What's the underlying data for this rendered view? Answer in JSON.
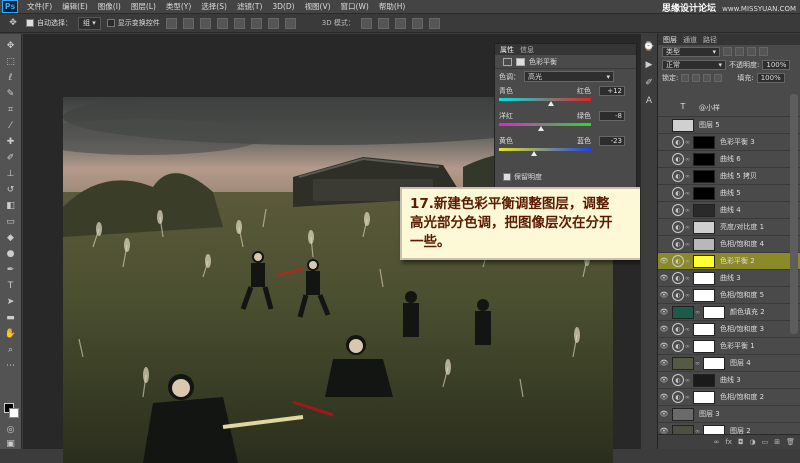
{
  "app": {
    "logo": "Ps",
    "menu": [
      "文件(F)",
      "编辑(E)",
      "图像(I)",
      "图层(L)",
      "类型(Y)",
      "选择(S)",
      "滤镜(T)",
      "3D(D)",
      "视图(V)",
      "窗口(W)",
      "帮助(H)"
    ],
    "watermark": "思缘设计论坛",
    "watermark_url": "www.MISSYUAN.COM"
  },
  "options": {
    "auto_select_label": "自动选择：",
    "auto_select_value": "组",
    "show_transform_label": "显示变换控件",
    "mode_3d": "3D 模式："
  },
  "properties": {
    "tabs": [
      "属性",
      "信息"
    ],
    "title": "色彩平衡",
    "tone_label": "色调：",
    "tone_value": "高光",
    "sliders": [
      {
        "left": "青色",
        "right": "红色",
        "value": "+12",
        "position": 0.56
      },
      {
        "left": "洋红",
        "right": "绿色",
        "value": "-8",
        "position": 0.46
      },
      {
        "left": "黄色",
        "right": "蓝色",
        "value": "-23",
        "position": 0.38
      }
    ],
    "preserve_label": "保留明度"
  },
  "callout": {
    "line1": "17.新建色彩平衡调整图层，调整",
    "line2": "高光部分色调，把图像层次在分开",
    "line3": "一些。"
  },
  "layers_panel": {
    "tabs": [
      "图层",
      "通道",
      "路径"
    ],
    "filter_kind": "类型",
    "blend_mode": "正常",
    "opacity_label": "不透明度:",
    "opacity_value": "100%",
    "lock_label": "锁定:",
    "fill_label": "填充:",
    "fill_value": "100%",
    "layers": [
      {
        "name": "@小样",
        "type": "text",
        "visible": false
      },
      {
        "name": "图层 5",
        "type": "pixel",
        "visible": false,
        "thumb": "#d0d0d0"
      },
      {
        "name": "色彩平衡 3",
        "type": "adj",
        "visible": false,
        "mask": "#000000"
      },
      {
        "name": "曲线 6",
        "type": "adj",
        "visible": false,
        "mask": "#000000"
      },
      {
        "name": "曲线 5 拷贝",
        "type": "adj",
        "visible": false,
        "mask": "#000000"
      },
      {
        "name": "曲线 5",
        "type": "adj",
        "visible": false,
        "mask": "#000000"
      },
      {
        "name": "曲线 4",
        "type": "adj",
        "visible": false,
        "mask": "#2a2a2a"
      },
      {
        "name": "亮度/对比度 1",
        "type": "adj",
        "visible": false,
        "mask": "#cfcfcf"
      },
      {
        "name": "色相/饱和度 4",
        "type": "adj",
        "visible": false,
        "mask": "#b8b8b8"
      },
      {
        "name": "色彩平衡 2",
        "type": "adj",
        "visible": true,
        "mask": "#ffff33",
        "selected": true
      },
      {
        "name": "曲线 3",
        "type": "adj",
        "visible": true,
        "mask": "#ffffff"
      },
      {
        "name": "色相/饱和度 5",
        "type": "adj",
        "visible": true,
        "mask": "#ffffff"
      },
      {
        "name": "颜色填充 2",
        "type": "fill",
        "visible": true,
        "thumb": "#1d5a4c",
        "mask": "#ffffff"
      },
      {
        "name": "色相/饱和度 3",
        "type": "adj",
        "visible": true,
        "mask": "#ffffff"
      },
      {
        "name": "色彩平衡 1",
        "type": "adj",
        "visible": true,
        "mask": "#ffffff"
      },
      {
        "name": "图层 4",
        "type": "pixel",
        "visible": true,
        "thumb": "#555a44",
        "mask": "#ffffff"
      },
      {
        "name": "曲线 3",
        "type": "adj",
        "visible": true,
        "mask": "#1a1a1a"
      },
      {
        "name": "色相/饱和度 2",
        "type": "adj",
        "visible": true,
        "mask": "#ffffff"
      },
      {
        "name": "图层 3",
        "type": "pixel",
        "visible": true,
        "thumb": "#6a6a6a"
      },
      {
        "name": "图层 2",
        "type": "pixel",
        "visible": true,
        "thumb": "#4c5040",
        "mask": "#ffffff"
      }
    ]
  }
}
